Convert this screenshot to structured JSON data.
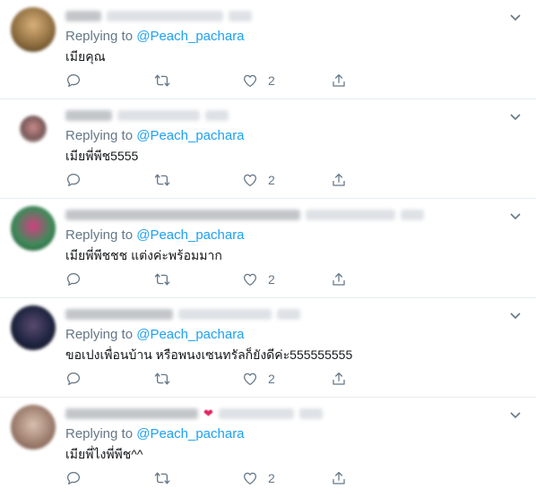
{
  "colors": {
    "accent": "#1da1f2",
    "muted": "#657786",
    "divider": "#e6ecf0"
  },
  "tweets": [
    {
      "avatar": {
        "color": "#8a6a3c",
        "small": false
      },
      "replying_prefix": "Replying to ",
      "mention": "@Peach_pachara",
      "text": "เมียคุณ",
      "like_count": "2"
    },
    {
      "avatar": {
        "color": "#7a5a5a",
        "small": true
      },
      "replying_prefix": "Replying to ",
      "mention": "@Peach_pachara",
      "text": "เมียพี่พีช5555",
      "like_count": "2"
    },
    {
      "avatar": {
        "color": "#3f8a5a",
        "small": false
      },
      "replying_prefix": "Replying to ",
      "mention": "@Peach_pachara",
      "text": "เมียพี่พีชชช แต่งค่ะพร้อมมาก",
      "like_count": "2"
    },
    {
      "avatar": {
        "color": "#1f2540",
        "small": false
      },
      "replying_prefix": "Replying to ",
      "mention": "@Peach_pachara",
      "text": "ขอเปงเพื่อนบ้าน หรือพนงเซนทรัลก็ยังดีค่ะ555555555",
      "like_count": "2"
    },
    {
      "avatar": {
        "color": "#a08070",
        "small": false
      },
      "replying_prefix": "Replying to ",
      "mention": "@Peach_pachara",
      "text": "เมียพี่ไงพี่พีช^^",
      "like_count": "2"
    }
  ]
}
